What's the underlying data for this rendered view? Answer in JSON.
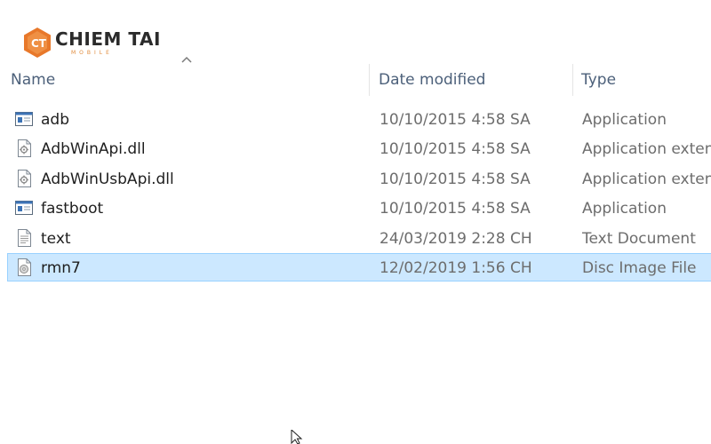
{
  "logo": {
    "main": "CHIEM TAI",
    "sub": "MOBILE"
  },
  "columns": {
    "name": "Name",
    "date": "Date modified",
    "type": "Type"
  },
  "files": [
    {
      "name": "adb",
      "date": "10/10/2015 4:58 SA",
      "type": "Application",
      "icon": "application-icon"
    },
    {
      "name": "AdbWinApi.dll",
      "date": "10/10/2015 4:58 SA",
      "type": "Application extension",
      "icon": "dll-icon"
    },
    {
      "name": "AdbWinUsbApi.dll",
      "date": "10/10/2015 4:58 SA",
      "type": "Application extension",
      "icon": "dll-icon"
    },
    {
      "name": "fastboot",
      "date": "10/10/2015 4:58 SA",
      "type": "Application",
      "icon": "application-icon"
    },
    {
      "name": "text",
      "date": "24/03/2019 2:28 CH",
      "type": "Text Document",
      "icon": "text-file-icon"
    },
    {
      "name": "rmn7",
      "date": "12/02/2019 1:56 CH",
      "type": "Disc Image File",
      "icon": "disc-image-icon",
      "selected": true
    }
  ],
  "colors": {
    "selection_bg": "#cce8ff",
    "selection_border": "#99d1ff",
    "header_text": "#4c607a",
    "logo_accent": "#e8782a"
  }
}
